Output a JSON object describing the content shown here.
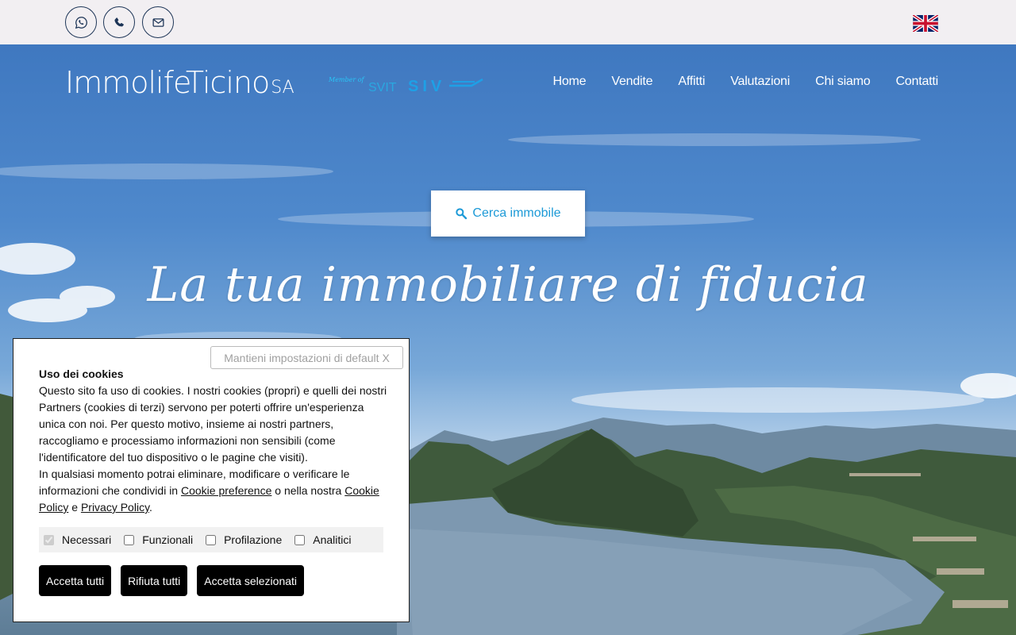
{
  "topbar": {
    "contacts": [
      {
        "icon": "whatsapp-icon"
      },
      {
        "icon": "phone-icon"
      },
      {
        "icon": "mail-icon"
      }
    ],
    "language_flag": "uk-flag-icon"
  },
  "header": {
    "logo_main": "ImmolifeTicino",
    "logo_suffix": "SA",
    "member_of": "Member of",
    "svit": "SVIT",
    "siv": "SIV"
  },
  "nav": {
    "items": [
      "Home",
      "Vendite",
      "Affitti",
      "Valutazioni",
      "Chi siamo",
      "Contatti"
    ]
  },
  "hero": {
    "search_label": "Cerca immobile",
    "tagline": "La tua immobiliare di fiducia"
  },
  "cookie": {
    "close_label": "Mantieni impostazioni di default X",
    "title": "Uso dei cookies",
    "text1": "Questo sito fa uso di cookies. I nostri cookies (propri) e quelli dei nostri Partners (cookies di terzi) servono per poterti offrire un'esperienza unica con noi. Per questo motivo, insieme ai nostri partners, raccogliamo e processiamo informazioni non sensibili (come l'identificatore del tuo dispositivo o le pagine che visiti).",
    "text2_a": "In qualsiasi momento potrai eliminare, modificare o verificare le informazioni che condividi in ",
    "link_preferences": "Cookie preference",
    "text2_b": " o nella nostra ",
    "link_cookie_policy": "Cookie Policy",
    "text2_c": " e ",
    "link_privacy": "Privacy Policy",
    "text2_d": ".",
    "options": [
      {
        "label": "Necessari",
        "checked": true,
        "disabled": true
      },
      {
        "label": "Funzionali",
        "checked": false,
        "disabled": false
      },
      {
        "label": "Profilazione",
        "checked": false,
        "disabled": false
      },
      {
        "label": "Analitici",
        "checked": false,
        "disabled": false
      }
    ],
    "buttons": {
      "accept_all": "Accetta tutti",
      "reject_all": "Rifiuta tutti",
      "accept_selected": "Accetta selezionati"
    }
  },
  "colors": {
    "accent": "#1d9ad7",
    "dark_navy": "#1d3557",
    "topbar_bg": "#f2eff2"
  }
}
